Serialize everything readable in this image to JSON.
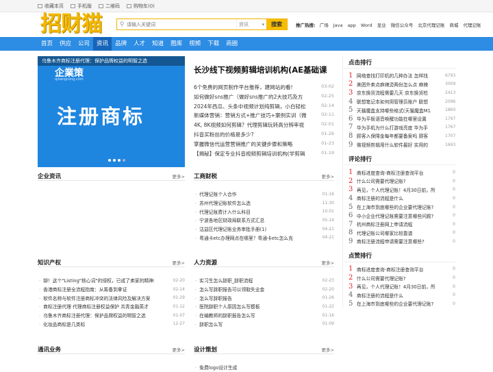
{
  "topbar": {
    "links": [
      "收藏本页",
      "手机版",
      "二维码",
      "购物车(0)"
    ]
  },
  "logo": "招财猫",
  "search": {
    "placeholder": "请输入关键词",
    "select": "资讯",
    "button": "搜索"
  },
  "hot": {
    "label": "推广热搜:",
    "words": [
      "广场",
      "Java",
      "app",
      "Word",
      "显业",
      "微信公众号",
      "北京代理记账",
      "商城",
      "代理记账"
    ]
  },
  "nav": [
    "首页",
    "供应",
    "公司",
    "资讯",
    "品牌",
    "人才",
    "知道",
    "图库",
    "视频",
    "下载",
    "商圈"
  ],
  "nav_active": 3,
  "banner": {
    "caption": "乌鲁木齐商标注册代理：保护品牌权益的明智之选",
    "brand": "企業策",
    "sub": "qibangcong.com",
    "big": "注册商标"
  },
  "headline": "长沙线下视频剪辑培训机构(AE基础课",
  "news": [
    {
      "t": "6个免费的网页制作平台推荐，建网站的看!",
      "d": "03-02"
    },
    {
      "t": "如何做好sns推广（做好sns推广的2大技巧及方",
      "d": "02-25"
    },
    {
      "t": "2024年西瓜、头条中视频计划纯剪辑，小白轻松",
      "d": "02-14"
    },
    {
      "t": "新媒体营销：营销方式+推广技巧+案例实训（微",
      "d": "02-11"
    },
    {
      "t": "4K, 8K视频如何剪辑？代理剪辑玩转高分辨率视",
      "d": "02-01"
    },
    {
      "t": "抖音买粉丝的价格是多少?",
      "d": "01-26"
    },
    {
      "t": "掌握微信代运营营销推广的关键步骤和策略",
      "d": "01-23"
    },
    {
      "t": "【揭秘】保定专业抖音视频剪辑培训机构(学剪辑",
      "d": "01-19"
    }
  ],
  "sections": {
    "enterprise": {
      "title": "企业资讯",
      "more": "更多>",
      "items": []
    },
    "tax": {
      "title": "工商财税",
      "more": "更多>",
      "items": [
        {
          "t": "代理记账个人合作",
          "d": "01-16"
        },
        {
          "t": "苏州代理记账软件怎么选",
          "d": "11-30"
        },
        {
          "t": "代理记账费计入什么科目",
          "d": "10-01"
        },
        {
          "t": "宁波各地区财政局联系方式汇总",
          "d": "05-14"
        },
        {
          "t": "沽益区代理记账业务审批手册(1)",
          "d": "04-21"
        },
        {
          "t": "粤通卡etc办理网点在哪里？粤通卡etc怎么充",
          "d": "04-21"
        }
      ]
    },
    "ip": {
      "title": "知识产权",
      "more": "更多>",
      "items": [
        {
          "t": "铆！这个\"Listing\"核心词\"的侵权，已成了卖家的精神内",
          "d": "02-20"
        },
        {
          "t": "香港商标注册全流程指南：从筹备到拿证",
          "d": "02-14"
        },
        {
          "t": "软件名称与软件注册商标冲突的法律风险及解决方案",
          "d": "01-29"
        },
        {
          "t": "商标注册代理 代理商标注册权益保护 共青金融英才",
          "d": "01-12"
        },
        {
          "t": "乌鲁木齐商标注册代理：保护品牌权益的明智之选",
          "d": "01-07"
        },
        {
          "t": "化妆品商标是几类标",
          "d": "12-27"
        }
      ]
    },
    "hr": {
      "title": "人力资源",
      "more": "更多>",
      "items": [
        {
          "t": "实习生怎么辞职_辞职流程",
          "d": "02-23"
        },
        {
          "t": "怎么写辞职报告可以领取失业金",
          "d": "02-20"
        },
        {
          "t": "怎么写辞职报告",
          "d": "01-26"
        },
        {
          "t": "医院辞职个人原因怎么写模板",
          "d": "01-22"
        },
        {
          "t": "在编教师的辞职报告怎么写",
          "d": "01-16"
        },
        {
          "t": "辞职怎么写",
          "d": "01-09"
        }
      ]
    },
    "comm": {
      "title": "通讯业务",
      "more": "更多>"
    },
    "design": {
      "title": "设计策划",
      "more": "更多>",
      "items": [
        {
          "t": "免费logo设计生成",
          "d": ""
        }
      ]
    }
  },
  "ranks": [
    {
      "title": "点击排行",
      "items": [
        {
          "t": "网络查找打印机的几种办法 怎样找",
          "c": "6793"
        },
        {
          "t": "美团外卖点麻辣烫两份怎么点 麻辣",
          "c": "3009"
        },
        {
          "t": "京东换货流程需要几天 京东换货检",
          "c": "2413"
        },
        {
          "t": "联想笔记本如何用管理员账户 联想",
          "c": "2096"
        },
        {
          "t": "天猫魔盒支持哪些格式(天猫魔盒M1",
          "c": "1860"
        },
        {
          "t": "华为平板语音唤醒功能在哪里设置",
          "c": "1797"
        },
        {
          "t": "华为手机为什么打游戏亮度 华为手",
          "c": "1767"
        },
        {
          "t": "顾客入保障金每年都要备案吗 顾客",
          "c": "1707"
        },
        {
          "t": "微视频剪辑用什么软件最好 实用的",
          "c": "1693"
        }
      ]
    },
    {
      "title": "评论排行",
      "items": [
        {
          "t": "商标进度查询-商标注册查询平台",
          "c": "0"
        },
        {
          "t": "什么公司需要代理记账?",
          "c": "0"
        },
        {
          "t": "再见，个人代理记账！4月30日前，所",
          "c": "0"
        },
        {
          "t": "商标注册的流程是什么",
          "c": "0"
        },
        {
          "t": "在上海市到底哪些的企业要代理记账?",
          "c": "0"
        },
        {
          "t": "中小企业代理记账需要注意哪些问题?",
          "c": "0"
        },
        {
          "t": "杭州商标注册网上申请流程",
          "c": "0"
        },
        {
          "t": "代理记账公司哪家比较靠谱",
          "c": "0"
        },
        {
          "t": "商标注册流程申请需要注意哪些?",
          "c": "0"
        }
      ]
    },
    {
      "title": "点赞排行",
      "items": [
        {
          "t": "商标进度查询-商标注册查询平台",
          "c": "0"
        },
        {
          "t": "什么公司需要代理记账?",
          "c": "0"
        },
        {
          "t": "再见，个人代理记账！4月30日前，所",
          "c": "0"
        },
        {
          "t": "商标注册的流程是什么",
          "c": "0"
        },
        {
          "t": "在上海市到底哪些的企业要代理记账?",
          "c": "0"
        }
      ]
    }
  ]
}
